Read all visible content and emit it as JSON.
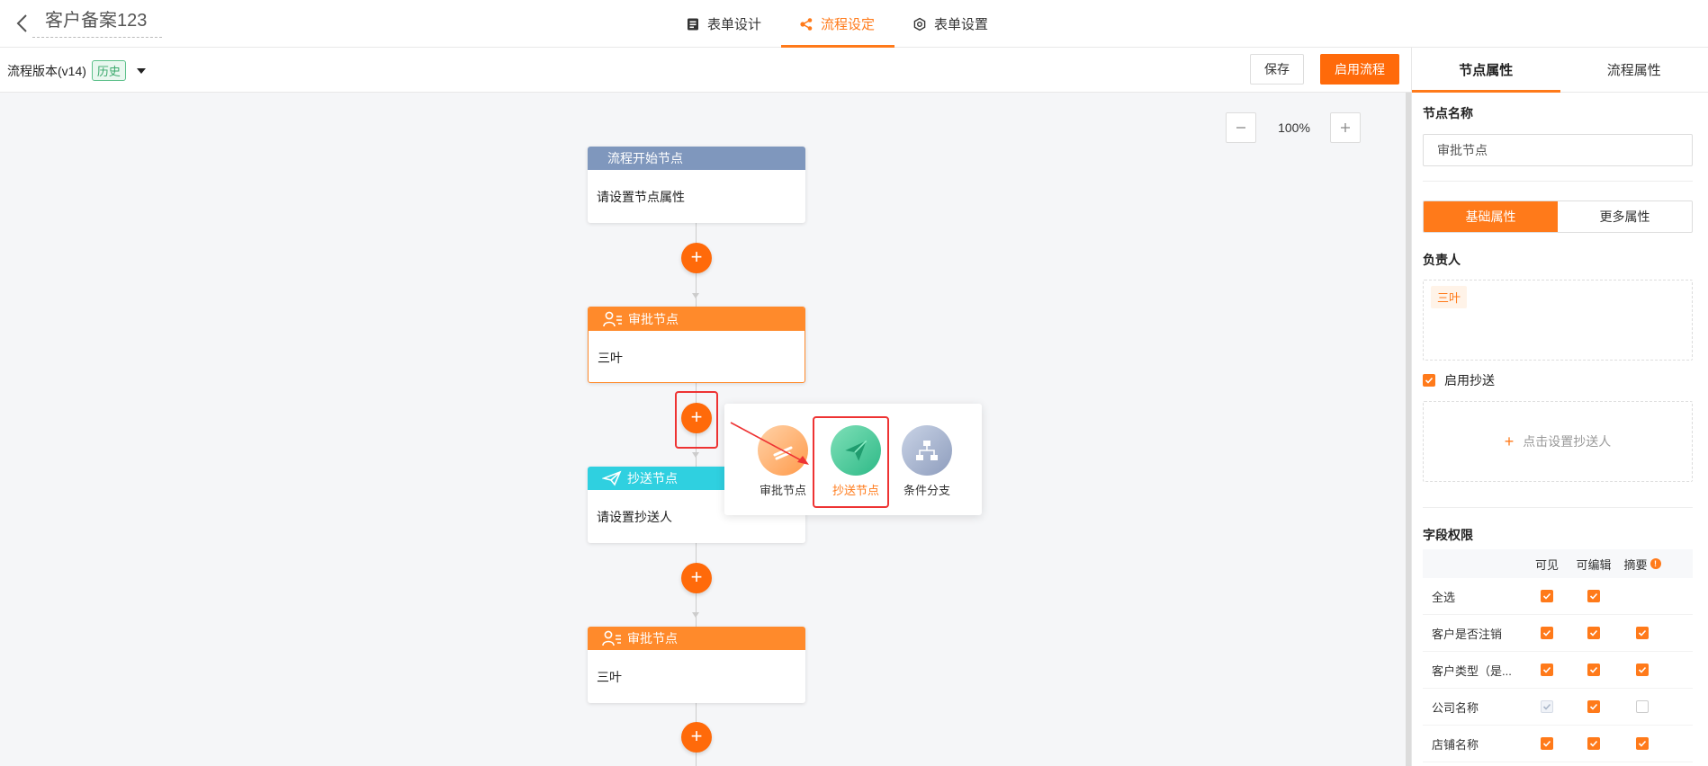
{
  "header": {
    "title": "客户备案123",
    "tabs": [
      {
        "label": "表单设计",
        "icon": "form-icon"
      },
      {
        "label": "流程设定",
        "icon": "flow-icon"
      },
      {
        "label": "表单设置",
        "icon": "settings-icon"
      }
    ],
    "active_tab": "流程设定"
  },
  "toolbar": {
    "version_label": "流程版本(v14)",
    "history_badge": "历史",
    "save_label": "保存",
    "start_label": "启用流程"
  },
  "canvas": {
    "zoom": "100%",
    "nodes": [
      {
        "type": "start",
        "title": "流程开始节点",
        "body": "请设置节点属性"
      },
      {
        "type": "approval",
        "title": "审批节点",
        "body": "三叶"
      },
      {
        "type": "cc",
        "title": "抄送节点",
        "body": "请设置抄送人"
      },
      {
        "type": "approval",
        "title": "审批节点",
        "body": "三叶"
      }
    ],
    "add_menu": [
      {
        "label": "审批节点",
        "icon": "approval-icon"
      },
      {
        "label": "抄送节点",
        "icon": "send-icon"
      },
      {
        "label": "条件分支",
        "icon": "branch-icon"
      }
    ]
  },
  "panel": {
    "tabs": [
      "节点属性",
      "流程属性"
    ],
    "node_name_label": "节点名称",
    "node_name_value": "审批节点",
    "segments": [
      "基础属性",
      "更多属性"
    ],
    "owner_label": "负责人",
    "owner_tag": "三叶",
    "enable_cc_label": "启用抄送",
    "cc_add_label": "点击设置抄送人",
    "field_perm_label": "字段权限",
    "perm_columns": [
      "可见",
      "可编辑",
      "摘要"
    ],
    "perm_rows": [
      {
        "name": "全选",
        "visible": "on",
        "editable": "on",
        "summary": "none"
      },
      {
        "name": "客户是否注销",
        "visible": "on",
        "editable": "on",
        "summary": "on"
      },
      {
        "name": "客户类型（是...",
        "visible": "on",
        "editable": "on",
        "summary": "on"
      },
      {
        "name": "公司名称",
        "visible": "dis",
        "editable": "on",
        "summary": "off"
      },
      {
        "name": "店铺名称",
        "visible": "on",
        "editable": "on",
        "summary": "on"
      }
    ]
  },
  "colors": {
    "accent": "#ff7a1a",
    "start_node": "#7f97bd",
    "approval_node": "#ff8a2b",
    "cc_node": "#2fd0e0",
    "highlight": "#e33333"
  }
}
